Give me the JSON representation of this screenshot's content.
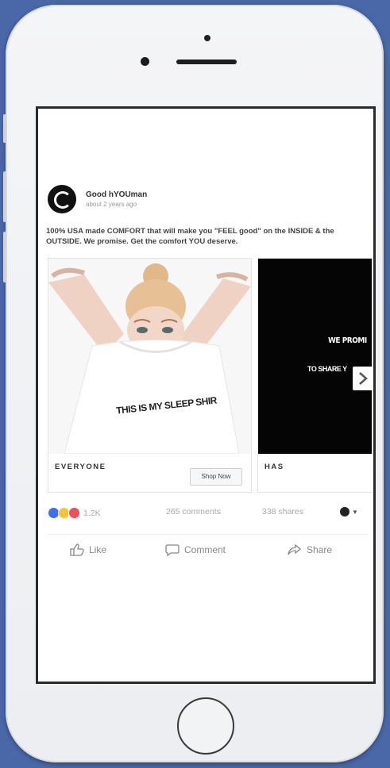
{
  "post": {
    "page_name": "Good hYOUman",
    "time": "about 2 years ago",
    "text": "100% USA made COMFORT that will make you \"FEEL good\" on the INSIDE & the OUTSIDE. We promise. Get the comfort YOU deserve."
  },
  "carousel": {
    "cards": [
      {
        "image_caption": "THIS IS MY SLEEP SHIR",
        "label": "EVERYONE",
        "cta": "Shop Now"
      },
      {
        "overlay_line_1": "WE PROMI",
        "overlay_line_2": "TO SHARE Y",
        "label": "HAS"
      }
    ],
    "next_icon": "chevron-right-icon"
  },
  "stats": {
    "reaction_count": "1.2K",
    "comments": "265 comments",
    "shares": "338 shares",
    "reaction_icons": [
      "like-reaction-icon",
      "haha-reaction-icon",
      "love-reaction-icon"
    ]
  },
  "actions": {
    "like": "Like",
    "comment": "Comment",
    "share": "Share"
  },
  "colors": {
    "background": "#4a67a8",
    "like_blue": "#3b6ff0",
    "love_red": "#f04e5e",
    "haha_yellow": "#f5c33b"
  }
}
